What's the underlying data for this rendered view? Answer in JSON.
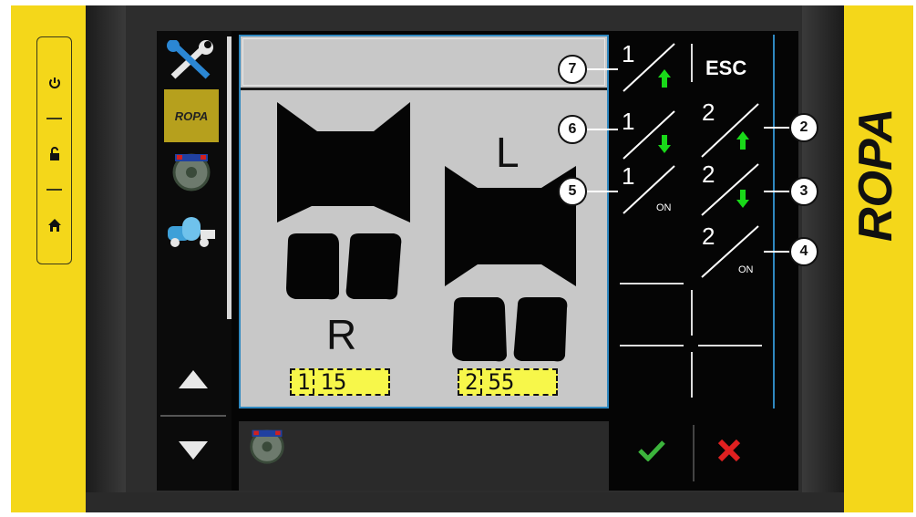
{
  "device": {
    "brand": "ROPA",
    "side_buttons": [
      {
        "icon": "power-icon"
      },
      {
        "icon": "unlock-icon"
      },
      {
        "icon": "home-icon"
      }
    ]
  },
  "sidebar": {
    "items": [
      {
        "icon": "tools-icon"
      },
      {
        "label": "ROPA",
        "icon": "ropa-logo"
      },
      {
        "icon": "steering-wheel-icon"
      },
      {
        "icon": "tank-vehicle-icon"
      }
    ],
    "scroll_up_icon": "triangle-up-icon",
    "scroll_down_icon": "triangle-down-icon"
  },
  "main": {
    "left_label": "R",
    "right_label": "L",
    "left_readout": {
      "index": "1",
      "value": "15"
    },
    "right_readout": {
      "index": "2",
      "value": "55"
    }
  },
  "softkeys": {
    "esc_label": "ESC",
    "keys": [
      {
        "num": "1",
        "action": "up",
        "callout": "7"
      },
      {
        "num": "1",
        "action": "down",
        "callout": "6"
      },
      {
        "num": "1",
        "action": "ON",
        "callout": "5"
      },
      {
        "num": "2",
        "action": "up",
        "callout": "2"
      },
      {
        "num": "2",
        "action": "down",
        "callout": "3"
      },
      {
        "num": "2",
        "action": "ON",
        "callout": "4"
      }
    ]
  },
  "bottom": {
    "confirm_icon": "check-icon",
    "cancel_icon": "close-icon",
    "colors": {
      "confirm": "#3cb43c",
      "cancel": "#e02020",
      "accent": "#f4d71a",
      "frame": "#2f88c0"
    }
  }
}
